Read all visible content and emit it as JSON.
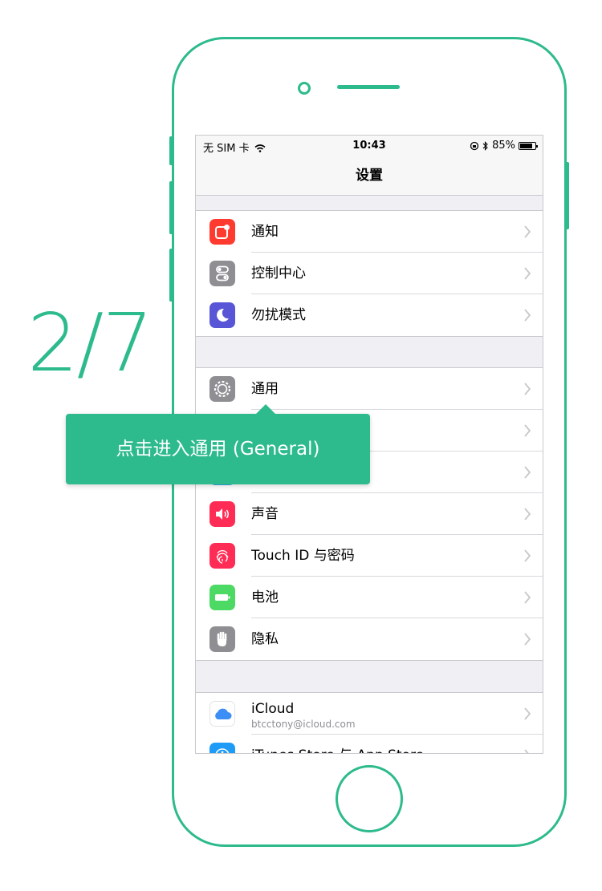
{
  "step_counter": "2/7",
  "status_bar": {
    "carrier": "无 SIM 卡",
    "time": "10:43",
    "battery_percent": "85%"
  },
  "nav": {
    "title": "设置"
  },
  "groups": [
    [
      {
        "label": "通知",
        "icon": "notifications-icon",
        "color": "#ff3b30"
      },
      {
        "label": "控制中心",
        "icon": "control-center-icon",
        "color": "#8e8e93"
      },
      {
        "label": "勿扰模式",
        "icon": "moon-icon",
        "color": "#5856d6"
      }
    ],
    [
      {
        "label": "通用",
        "icon": "gear-icon",
        "color": "#8e8e93"
      },
      {
        "label": "",
        "icon": "display-icon",
        "color": "#007aff"
      },
      {
        "label": "",
        "icon": "wallpaper-icon",
        "color": "#34aadc"
      },
      {
        "label": "声音",
        "icon": "speaker-icon",
        "color": "#ff2d55"
      },
      {
        "label": "Touch ID 与密码",
        "icon": "fingerprint-icon",
        "color": "#ff2d55"
      },
      {
        "label": "电池",
        "icon": "battery-icon",
        "color": "#4cd964"
      },
      {
        "label": "隐私",
        "icon": "hand-icon",
        "color": "#8e8e93"
      }
    ],
    [
      {
        "label": "iCloud",
        "sublabel": "btcctony@icloud.com",
        "icon": "icloud-icon",
        "color": "#ffffff"
      },
      {
        "label": "iTunes Store 与 App Store",
        "icon": "app-store-icon",
        "color": "#1d9bf6"
      }
    ]
  ],
  "tooltip": {
    "text": "点击进入通用 (General)"
  },
  "colors": {
    "accent": "#2dba8c"
  }
}
